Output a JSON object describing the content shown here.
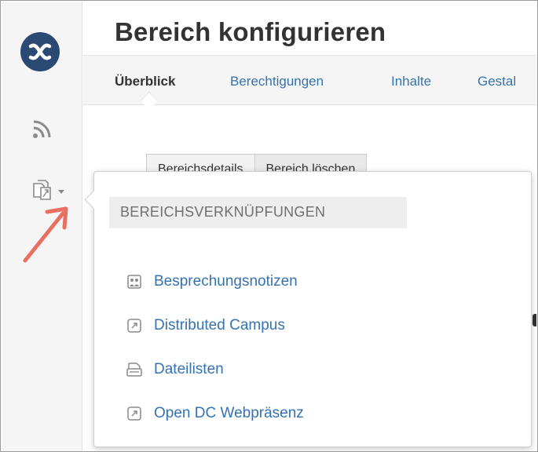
{
  "page": {
    "title": "Bereich konfigurieren"
  },
  "tabs": [
    {
      "label": "Überblick",
      "active": true
    },
    {
      "label": "Berechtigungen",
      "active": false
    },
    {
      "label": "Inhalte",
      "active": false
    },
    {
      "label": "Gestal",
      "active": false
    }
  ],
  "sub_buttons": [
    {
      "label": "Bereichsdetails"
    },
    {
      "label": "Bereich löschen"
    }
  ],
  "sidebar": {
    "logo_icon": "confluence-logo-icon",
    "feed_icon": "rss-feed-icon",
    "links_icon": "space-links-icon",
    "links_caret_icon": "caret-down-icon"
  },
  "popup": {
    "heading": "BEREICHSVERKNÜPFUNGEN",
    "items": [
      {
        "label": "Besprechungsnotizen",
        "icon": "meeting-notes-icon"
      },
      {
        "label": "Distributed Campus",
        "icon": "external-link-icon"
      },
      {
        "label": "Dateilisten",
        "icon": "file-list-icon"
      },
      {
        "label": "Open DC Webpräsenz",
        "icon": "external-link-icon"
      }
    ]
  },
  "colors": {
    "link": "#3572b0",
    "logo_bg": "#2a4a73",
    "annotation_arrow": "#e87060",
    "heading_bg": "#eeeeee"
  }
}
